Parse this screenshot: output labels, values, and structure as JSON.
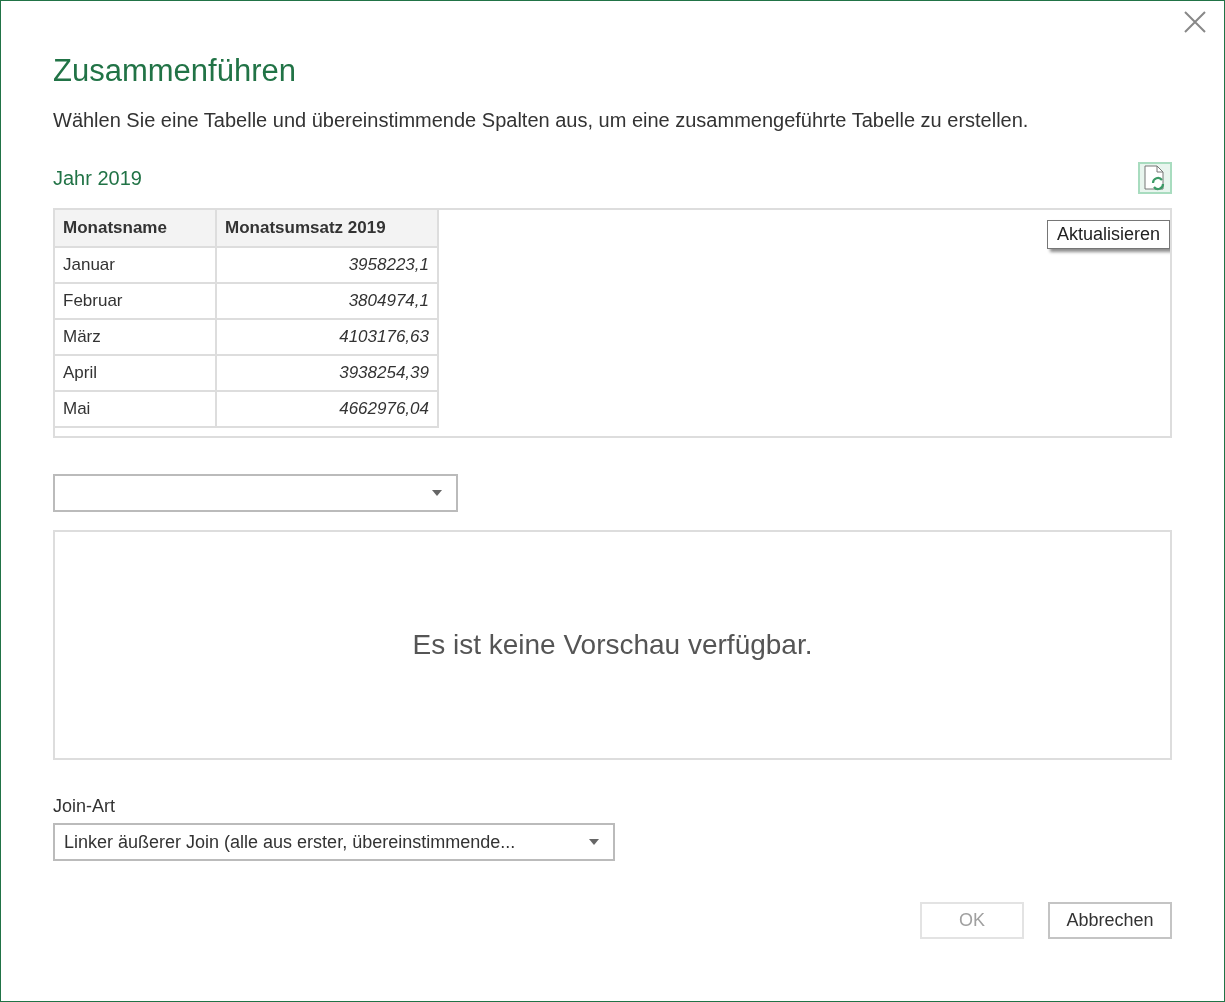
{
  "window": {
    "title": "Zusammenführen",
    "description": "Wählen Sie eine Tabelle und übereinstimmende Spalten aus, um eine zusammengeführte Tabelle zu erstellen."
  },
  "first_table": {
    "name": "Jahr 2019",
    "refresh_tooltip": "Aktualisieren",
    "columns": [
      "Monatsname",
      "Monatsumsatz 2019"
    ],
    "rows": [
      [
        "Januar",
        "3958223,1"
      ],
      [
        "Februar",
        "3804974,1"
      ],
      [
        "März",
        "4103176,63"
      ],
      [
        "April",
        "3938254,39"
      ],
      [
        "Mai",
        "4662976,04"
      ]
    ]
  },
  "second_table": {
    "empty_message": "Es ist keine Vorschau verfügbar."
  },
  "join": {
    "label": "Join-Art",
    "value": "Linker äußerer Join (alle aus erster, übereinstimmende..."
  },
  "buttons": [
    {
      "label": "OK",
      "disabled": true
    },
    {
      "label": "Abbrechen",
      "disabled": false
    }
  ]
}
